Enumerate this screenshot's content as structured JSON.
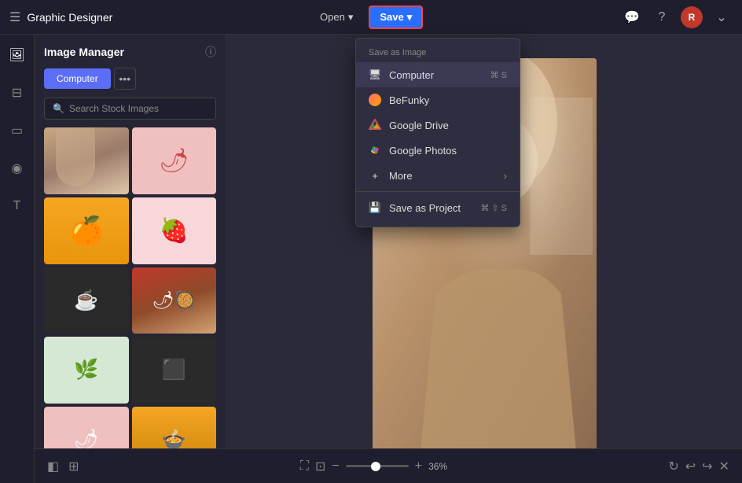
{
  "header": {
    "app_title": "Graphic Designer",
    "open_label": "Open",
    "save_label": "Save",
    "chevron_down": "▾"
  },
  "sidebar": {
    "title": "Image Manager",
    "computer_tab": "Computer",
    "more_tab": "•••",
    "search_placeholder": "Search Stock Images"
  },
  "dropdown": {
    "section_label": "Save as Image",
    "items": [
      {
        "id": "computer",
        "label": "Computer",
        "shortcut": "⌘ S",
        "highlighted": true
      },
      {
        "id": "befunky",
        "label": "BeFunky"
      },
      {
        "id": "google-drive",
        "label": "Google Drive"
      },
      {
        "id": "google-photos",
        "label": "Google Photos"
      },
      {
        "id": "more",
        "label": "More",
        "has_chevron": true
      }
    ],
    "save_project_label": "Save as Project",
    "save_project_shortcut": "⌘ ⇧ S"
  },
  "bottom_toolbar": {
    "zoom_percent": "36%",
    "zoom_minus": "−",
    "zoom_plus": "+"
  },
  "icons": {
    "hamburger": "☰",
    "open_chevron": "▾",
    "save_chevron": "▾",
    "message": "💬",
    "help": "?",
    "layers": "⊕",
    "adjustments": "⊟",
    "layout": "▦",
    "people": "◉",
    "text": "T",
    "info": "ⓘ",
    "search": "🔍",
    "fullscreen": "⛶",
    "crop": "⊡",
    "undo": "↩",
    "redo": "↪",
    "rotate": "↻",
    "layers_bottom": "◧",
    "grid_bottom": "⊞"
  }
}
